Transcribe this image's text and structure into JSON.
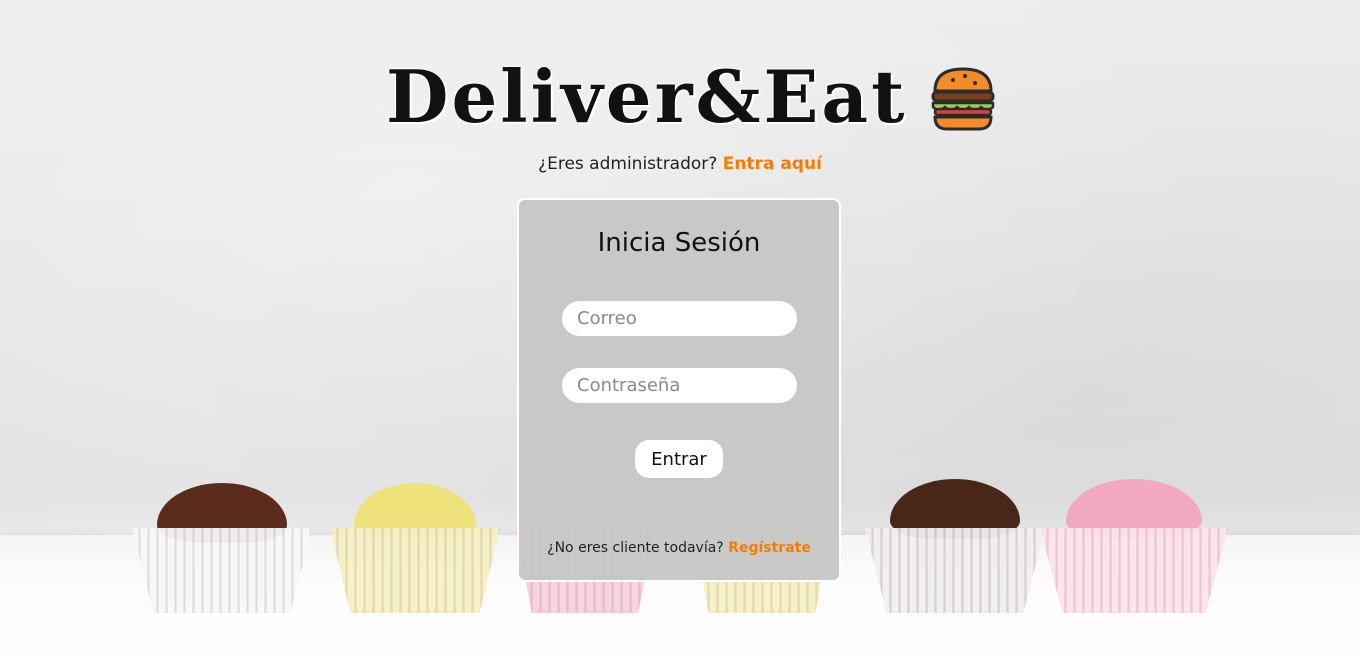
{
  "header": {
    "brand": "Deliver&Eat",
    "logo_icon": "burger-icon",
    "admin_prompt": "¿Eres administrador?",
    "admin_link": "Entra aquí"
  },
  "login": {
    "title": "Inicia Sesión",
    "email_placeholder": "Correo",
    "password_placeholder": "Contraseña",
    "submit_label": "Entrar",
    "signup_prompt": "¿No eres cliente todavía?",
    "signup_link": "Regístrate"
  },
  "colors": {
    "accent": "#f57c00",
    "card_background": "#c6c6c6"
  }
}
